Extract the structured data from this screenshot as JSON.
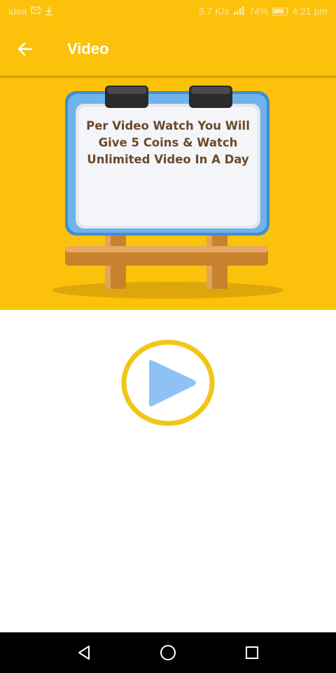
{
  "status_bar": {
    "carrier": "idea",
    "speed": "3.7 K/s",
    "battery": "74%",
    "time": "4:21 pm",
    "icons": [
      "message-icon",
      "download-icon",
      "signal-icon",
      "battery-icon"
    ]
  },
  "app_bar": {
    "title": "Video",
    "back_icon": "arrow-left-icon"
  },
  "banner": {
    "board_text": "Per Video Watch You Will Give 5 Coins & Watch Unlimited Video In A Day",
    "background": "#fcc10a"
  },
  "play_button": {
    "icon": "play-icon",
    "ring_color": "#f2c616",
    "triangle_color": "#8ec2f5"
  },
  "nav_bar": {
    "icons": [
      "nav-back-icon",
      "nav-home-icon",
      "nav-recents-icon"
    ]
  },
  "colors": {
    "accent": "#fcc10a",
    "title_text": "#ffffff",
    "board_text": "#6b4a2b"
  }
}
